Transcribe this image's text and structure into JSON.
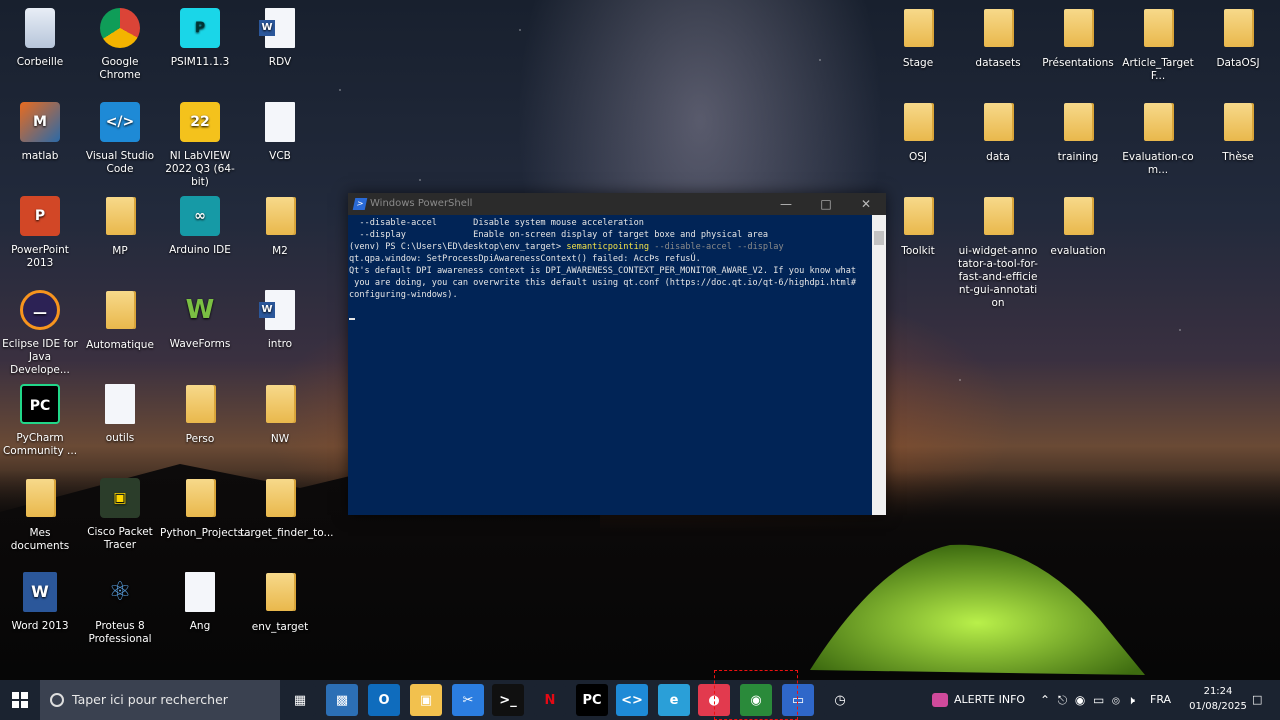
{
  "desktop_left": [
    {
      "label": "Corbeille",
      "type": "recycle"
    },
    {
      "label": "Google Chrome",
      "type": "chrome"
    },
    {
      "label": "PSIM11.1.3",
      "type": "psim"
    },
    {
      "label": "RDV",
      "type": "word-doc"
    },
    {
      "label": "matlab",
      "type": "matlab"
    },
    {
      "label": "Visual Studio Code",
      "type": "vscode"
    },
    {
      "label": "NI LabVIEW 2022 Q3 (64-bit)",
      "type": "labview"
    },
    {
      "label": "VCB",
      "type": "doc"
    },
    {
      "label": "PowerPoint 2013",
      "type": "ppt"
    },
    {
      "label": "MP",
      "type": "folder"
    },
    {
      "label": "Arduino IDE",
      "type": "arduino"
    },
    {
      "label": "M2",
      "type": "folder"
    },
    {
      "label": "Eclipse IDE for Java Develope...",
      "type": "eclipse"
    },
    {
      "label": "Automatique",
      "type": "folder"
    },
    {
      "label": "WaveForms",
      "type": "waveforms"
    },
    {
      "label": "intro",
      "type": "word-doc"
    },
    {
      "label": "PyCharm Community ...",
      "type": "pycharm"
    },
    {
      "label": "outils",
      "type": "doc"
    },
    {
      "label": "Perso",
      "type": "folder"
    },
    {
      "label": "NW",
      "type": "folder"
    },
    {
      "label": "Mes documents",
      "type": "folder"
    },
    {
      "label": "Cisco Packet Tracer",
      "type": "cisco"
    },
    {
      "label": "Python_Projects...",
      "type": "folder"
    },
    {
      "label": "target_finder_to...",
      "type": "folder"
    },
    {
      "label": "Word 2013",
      "type": "word"
    },
    {
      "label": "Proteus 8 Professional",
      "type": "proteus"
    },
    {
      "label": "Ang",
      "type": "doc"
    },
    {
      "label": "env_target",
      "type": "folder"
    }
  ],
  "desktop_right": [
    {
      "label": "Stage"
    },
    {
      "label": "datasets"
    },
    {
      "label": "Présentations"
    },
    {
      "label": "Article_TargetF..."
    },
    {
      "label": "DataOSJ"
    },
    {
      "label": "OSJ"
    },
    {
      "label": "data"
    },
    {
      "label": "training"
    },
    {
      "label": "Evaluation-com..."
    },
    {
      "label": "Thèse"
    },
    {
      "label": "Toolkit"
    },
    {
      "label": "ui-widget-annotator-a-tool-for-fast-and-efficient-gui-annotation"
    },
    {
      "label": "evaluation"
    }
  ],
  "powershell": {
    "title": "Windows PowerShell",
    "lines": [
      {
        "parts": [
          {
            "t": "  --disable-accel       Disable system mouse acceleration",
            "c": ""
          }
        ]
      },
      {
        "parts": [
          {
            "t": "  --display             Enable on-screen display of target boxe and physical area",
            "c": ""
          }
        ]
      },
      {
        "parts": [
          {
            "t": "(venv) PS C:\\Users\\ED\\desktop\\env_target> ",
            "c": ""
          },
          {
            "t": "semanticpointing",
            "c": "yellow"
          },
          {
            "t": " --disable-accel --display",
            "c": "grey"
          }
        ]
      },
      {
        "parts": [
          {
            "t": "qt.qpa.window: SetProcessDpiAwarenessContext() failed: AccÞs refusÚ.",
            "c": ""
          }
        ]
      },
      {
        "parts": [
          {
            "t": "Qt's default DPI awareness context is DPI_AWARENESS_CONTEXT_PER_MONITOR_AWARE_V2. If you know what",
            "c": ""
          }
        ]
      },
      {
        "parts": [
          {
            "t": " you are doing, you can overwrite this default using qt.conf (https://doc.qt.io/qt-6/highdpi.html#",
            "c": ""
          }
        ]
      },
      {
        "parts": [
          {
            "t": "configuring-windows).",
            "c": ""
          }
        ]
      }
    ]
  },
  "taskbar": {
    "search_placeholder": "Taper ici pour rechercher",
    "apps": [
      "task-view",
      "network-explorer",
      "outlook",
      "file-explorer",
      "snipping",
      "terminal",
      "netflix",
      "pycharm",
      "vscode",
      "edge",
      "drop-app",
      "chrome-acrobat",
      "remote-desktop",
      "monitor-app"
    ],
    "alert_label": "ALERTE INFO",
    "lang": "FRA",
    "time": "21:24",
    "date": "01/08/2025"
  }
}
